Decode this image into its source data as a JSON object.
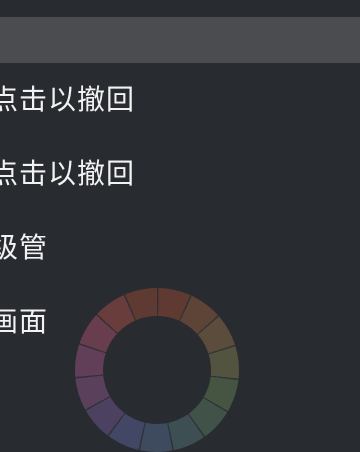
{
  "menu": {
    "items": [
      {
        "label": "点击以撤回"
      },
      {
        "label": "点击以撤回"
      },
      {
        "label": "级管"
      },
      {
        "label": "画面"
      }
    ]
  },
  "colors": {
    "background": "#282b30",
    "header": "#4a4c50",
    "text": "#f2f2f2"
  }
}
